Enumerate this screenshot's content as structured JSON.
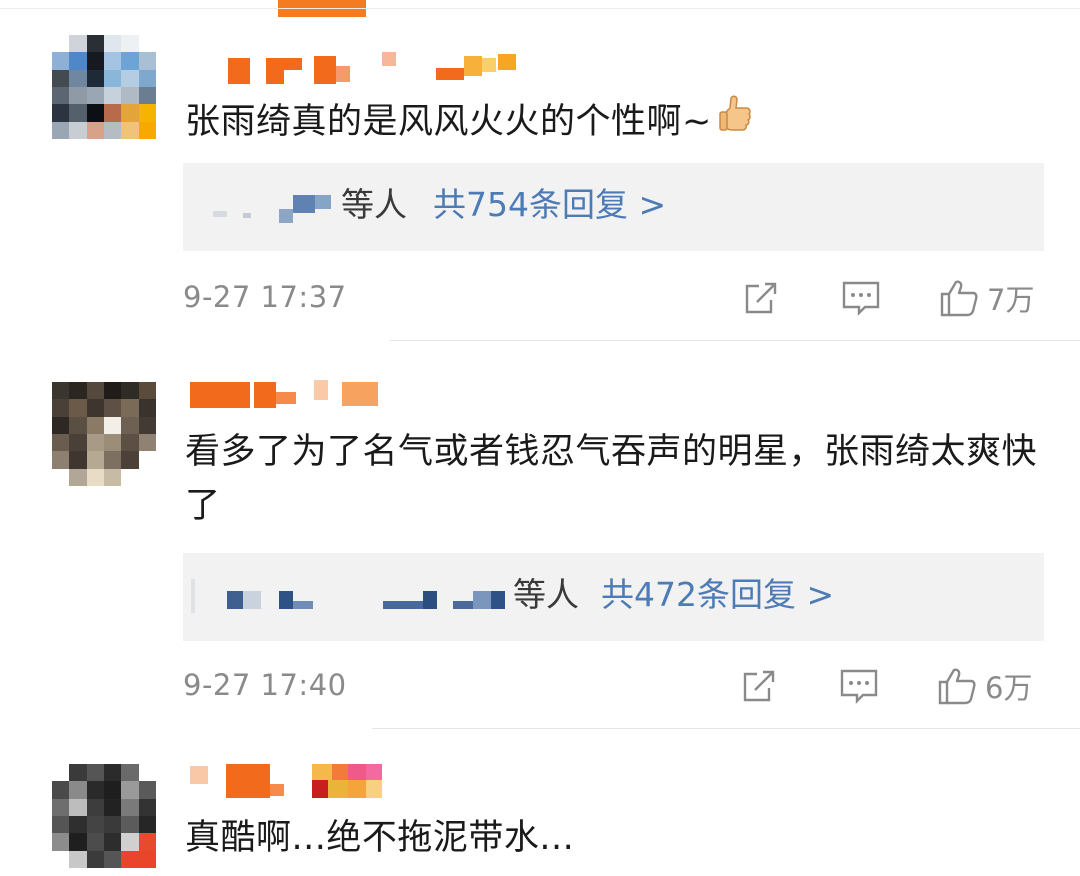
{
  "comments": [
    {
      "text": "张雨绮真的是风风火火的个性啊~",
      "reply_suffix": "等人",
      "reply_count": "共754条回复 >",
      "time": "9-27 17:37",
      "likes": "7万",
      "emoji": "thumbs-up-emoji"
    },
    {
      "text": "看多了为了名气或者钱忍气吞声的明星，张雨绮太爽快了",
      "reply_suffix": "等人",
      "reply_count": "共472条回复 >",
      "time": "9-27 17:40",
      "likes": "6万"
    },
    {
      "text": "真酷啊...绝不拖泥带水..."
    }
  ],
  "icons": {
    "share": "share-icon",
    "comment": "comment-icon",
    "like": "like-icon"
  },
  "colors": {
    "accent": "#f47b20",
    "link": "#4c7bb5",
    "meta": "#8a8a8a",
    "reply_bg": "#f2f2f2"
  }
}
